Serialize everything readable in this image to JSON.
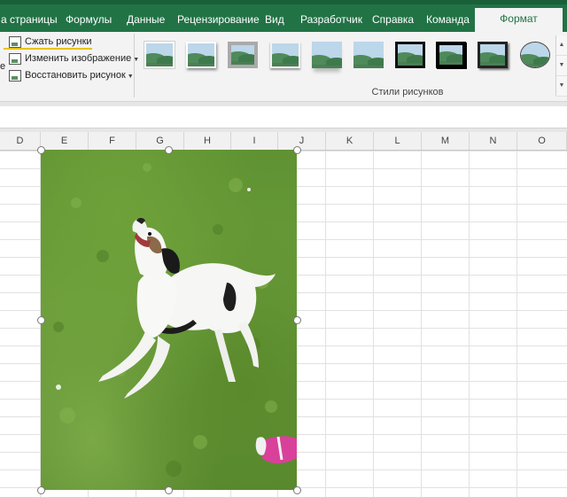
{
  "ribbon_tabs": [
    {
      "label": "а страницы"
    },
    {
      "label": "Формулы"
    },
    {
      "label": "Данные"
    },
    {
      "label": "Рецензирование"
    },
    {
      "label": "Вид"
    },
    {
      "label": "Разработчик"
    },
    {
      "label": "Справка"
    },
    {
      "label": "Команда"
    },
    {
      "label": "Формат"
    }
  ],
  "active_tab": "Формат",
  "adjust_group": {
    "edge_char": "е",
    "compress_label": "Сжать рисунки",
    "change_label": "Изменить изображение",
    "reset_label": "Восстановить рисунок"
  },
  "picture_styles": {
    "group_label": "Стили рисунков",
    "thumbnails": [
      {
        "name": "style-simple-frame-white"
      },
      {
        "name": "style-drop-shadow"
      },
      {
        "name": "style-thick-matte-gray"
      },
      {
        "name": "style-soft-edge"
      },
      {
        "name": "style-reflected"
      },
      {
        "name": "style-plain"
      },
      {
        "name": "style-simple-frame-black"
      },
      {
        "name": "style-thick-black"
      },
      {
        "name": "style-shadow-black"
      },
      {
        "name": "style-oval"
      }
    ]
  },
  "columns": [
    "D",
    "E",
    "F",
    "G",
    "H",
    "I",
    "J",
    "K",
    "L",
    "M",
    "N",
    "O"
  ],
  "colors": {
    "ribbon_green": "#217346",
    "ribbon_bg": "#f3f3f3",
    "highlight_yellow": "#e8c200"
  },
  "icons": {
    "compress": "compress-pictures-icon",
    "change": "change-picture-icon",
    "reset": "reset-picture-icon"
  }
}
